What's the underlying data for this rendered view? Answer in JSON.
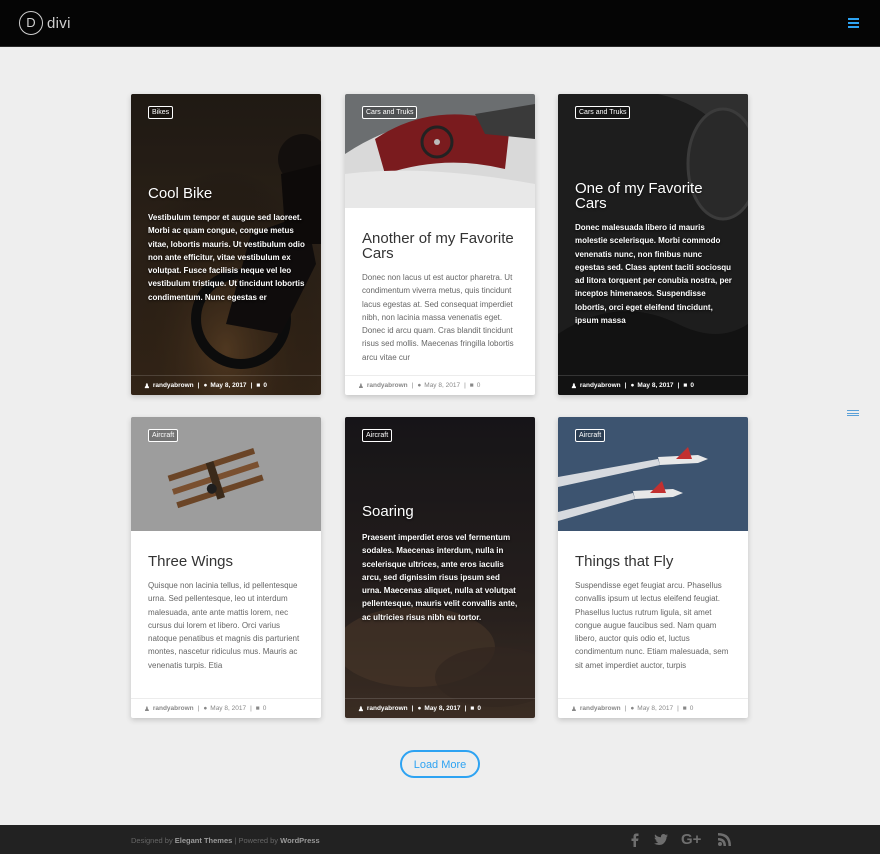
{
  "site": {
    "logo_mark": "D",
    "logo_text": "divi"
  },
  "posts": [
    {
      "category": "Bikes",
      "title": "Cool Bike",
      "excerpt": "Vestibulum tempor et augue sed laoreet. Morbi ac quam congue, congue metus vitae, lobortis mauris. Ut vestibulum odio non ante efficitur, vitae vestibulum ex volutpat. Fusce facilisis neque vel leo vestibulum tristique. Ut tincidunt lobortis condimentum. Nunc egestas er",
      "author": "randyabrown",
      "date": "May 8, 2017",
      "comments": "0"
    },
    {
      "category": "Cars and Truks",
      "title": "Another of my Favorite Cars",
      "excerpt": "Donec non lacus ut est auctor pharetra. Ut condimentum viverra metus, quis tincidunt lacus egestas at. Sed consequat imperdiet nibh, non lacinia massa venenatis eget. Donec id arcu quam. Cras blandit tincidunt risus sed mollis. Maecenas fringilla lobortis arcu vitae cur",
      "author": "randyabrown",
      "date": "May 8, 2017",
      "comments": "0"
    },
    {
      "category": "Cars and Truks",
      "title": "One of my Favorite Cars",
      "excerpt": "Donec malesuada libero id mauris molestie scelerisque. Morbi commodo venenatis nunc, non finibus nunc egestas sed. Class aptent taciti sociosqu ad litora torquent per conubia nostra, per inceptos himenaeos. Suspendisse lobortis, orci eget eleifend tincidunt, ipsum massa",
      "author": "randyabrown",
      "date": "May 8, 2017",
      "comments": "0"
    },
    {
      "category": "Aircraft",
      "title": "Three Wings",
      "excerpt": "Quisque non lacinia tellus, id pellentesque urna. Sed pellentesque, leo ut interdum malesuada, ante ante mattis lorem, nec cursus dui lorem et libero. Orci varius natoque penatibus et magnis dis parturient montes, nascetur ridiculus mus. Mauris ac venenatis turpis. Etia",
      "author": "randyabrown",
      "date": "May 8, 2017",
      "comments": "0"
    },
    {
      "category": "Aircraft",
      "title": "Soaring",
      "excerpt": "Praesent imperdiet eros vel fermentum sodales. Maecenas interdum, nulla in scelerisque ultrices, ante eros iaculis arcu, sed dignissim risus ipsum sed urna. Maecenas aliquet, nulla at volutpat pellentesque, mauris velit convallis ante, ac ultricies risus nibh eu tortor.",
      "author": "randyabrown",
      "date": "May 8, 2017",
      "comments": "0"
    },
    {
      "category": "Aircraft",
      "title": "Things that Fly",
      "excerpt": "Suspendisse eget feugiat arcu. Phasellus convallis ipsum ut lectus eleifend feugiat. Phasellus luctus rutrum ligula, sit amet congue augue faucibus sed. Nam quam libero, auctor quis odio et, luctus condimentum nunc. Etiam malesuada, sem sit amet imperdiet auctor, turpis",
      "author": "randyabrown",
      "date": "May 8, 2017",
      "comments": "0"
    }
  ],
  "meta_separator": "|",
  "load_more_label": "Load More",
  "footer": {
    "designed_by": "Designed by",
    "elegant_themes": "Elegant Themes",
    "powered_by": "| Powered by",
    "wordpress": "WordPress"
  },
  "social_icons": [
    "facebook-icon",
    "twitter-icon",
    "google-plus-icon",
    "rss-icon"
  ],
  "colors": {
    "accent": "#2ea3f2",
    "header_bg": "#050505",
    "footer_bg": "#222222",
    "page_bg": "#eeeeee"
  }
}
